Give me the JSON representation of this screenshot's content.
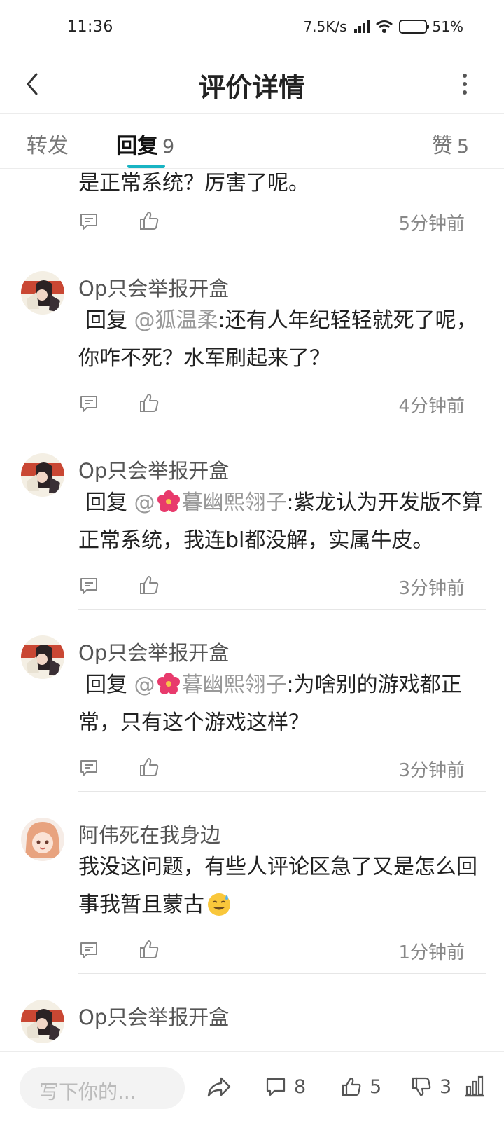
{
  "status_bar": {
    "time": "11:36",
    "network_speed": "7.5K/s",
    "battery_level": 0.51,
    "battery_text": "51%"
  },
  "nav": {
    "title": "评价详情"
  },
  "tabs": {
    "forward": "转发",
    "reply": "回复",
    "reply_count": "9",
    "like": "赞",
    "like_count": "5",
    "accent_color": "#18b4c3"
  },
  "comments": [
    {
      "text": "是正常系统？厉害了呢。",
      "time": "5分钟前"
    },
    {
      "author": "Op只会举报开盒",
      "reply_prefix": "回复",
      "mention": "@狐温柔",
      "text": ":还有人年纪轻轻就死了呢，你咋不死？水军刷起来了？",
      "time": "4分钟前"
    },
    {
      "author": "Op只会举报开盒",
      "reply_prefix": "回复",
      "mention_at": "@",
      "mention_name": "暮幽熙翎子",
      "text": ":紫龙认为开发版不算正常系统，我连bl都没解，实属牛皮。",
      "time": "3分钟前"
    },
    {
      "author": "Op只会举报开盒",
      "reply_prefix": "回复",
      "mention_at": "@",
      "mention_name": "暮幽熙翎子",
      "text": ":为啥别的游戏都正常，只有这个游戏这样？",
      "time": "3分钟前"
    },
    {
      "author": "阿伟死在我身边",
      "text": "我没这问题，有些人评论区急了又是怎么回事我暂且蒙古",
      "emoji": "sweat-smile-emoji",
      "time": "1分钟前"
    },
    {
      "author": "Op只会举报开盒"
    }
  ],
  "bottom_bar": {
    "input_placeholder": "写下你的...",
    "comment_count": "8",
    "like_count": "5",
    "dislike_count": "3"
  }
}
